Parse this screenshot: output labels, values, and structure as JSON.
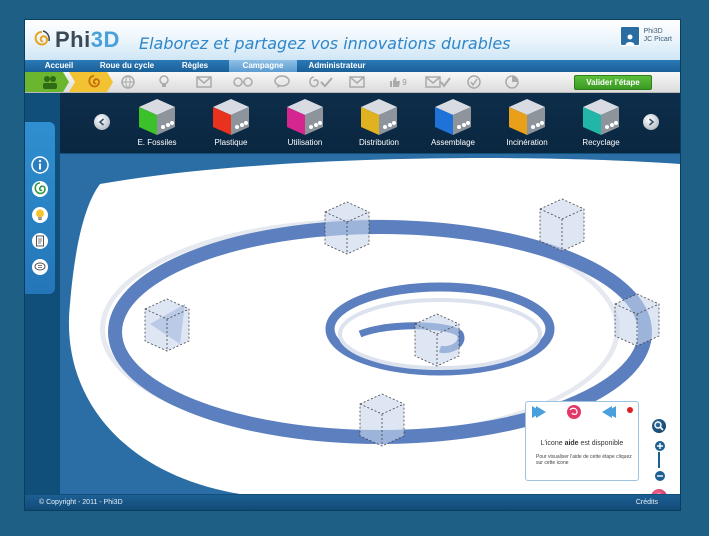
{
  "header": {
    "logo_text_main": "Phi",
    "logo_text_accent": "3D",
    "tagline": "Elaborez et partagez vos innovations durables",
    "user_line1": "Phi3D",
    "user_line2": "JC Picart"
  },
  "nav": {
    "items": [
      "Accueil",
      "Roue du cycle",
      "Règles",
      "Campagne",
      "Administrateur"
    ],
    "active": "Campagne"
  },
  "stepbar": {
    "validate_label": "Valider l'étape",
    "like_count": "9"
  },
  "categories": [
    {
      "label": "E. Fossiles",
      "color": "#3cc12a"
    },
    {
      "label": "Plastique",
      "color": "#e8321e"
    },
    {
      "label": "Utilisation",
      "color": "#d5258f"
    },
    {
      "label": "Distribution",
      "color": "#e0b220"
    },
    {
      "label": "Assemblage",
      "color": "#1f73d8"
    },
    {
      "label": "Incinération",
      "color": "#e89f1a"
    },
    {
      "label": "Recyclage",
      "color": "#22b6a8"
    }
  ],
  "help": {
    "title_pre": "L'icone ",
    "title_bold": "aide",
    "title_post": " est disponible",
    "body": "Pour visualiser l'aide de cette étape cliquez sur cette icone"
  },
  "footer": {
    "copyright": "© Copyright - 2011 - Phi3D",
    "credits": "Crédits"
  }
}
